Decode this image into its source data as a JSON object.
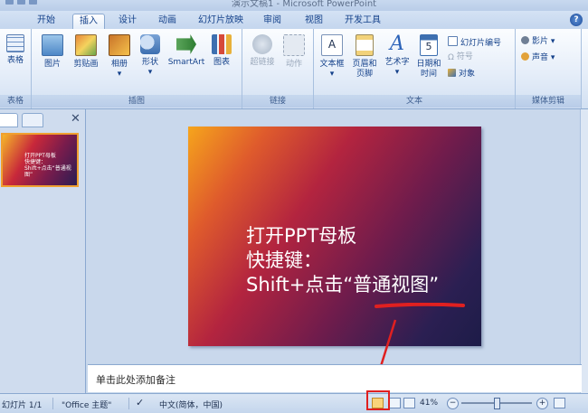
{
  "window": {
    "title": "演示文稿1 - Microsoft PowerPoint"
  },
  "tabs": [
    {
      "label": "开始"
    },
    {
      "label": "插入",
      "active": true
    },
    {
      "label": "设计"
    },
    {
      "label": "动画"
    },
    {
      "label": "幻灯片放映"
    },
    {
      "label": "审阅"
    },
    {
      "label": "视图"
    },
    {
      "label": "开发工具"
    }
  ],
  "ribbon": {
    "groups": {
      "tables": "表格",
      "illustrations": "插图",
      "links": "链接",
      "text": "文本",
      "media": "媒体剪辑"
    },
    "buttons": {
      "table": "表格",
      "picture": "图片",
      "clipart": "剪贴画",
      "album": "相册",
      "shapes": "形状",
      "smartart": "SmartArt",
      "chart": "图表",
      "hyperlink": "超链接",
      "action": "动作",
      "textbox": "文本框",
      "header_footer_1": "页眉和",
      "header_footer_2": "页脚",
      "wordart": "艺术字",
      "datetime_1": "日期和",
      "datetime_2": "时间",
      "slide_number": "幻灯片编号",
      "symbol": "符号",
      "object": "对象",
      "movie": "影片",
      "sound": "声音"
    }
  },
  "slide": {
    "line1": "打开PPT母板",
    "line2": "快捷键：",
    "line3_prefix": "Shift+点击",
    "line3_highlight": "“普通视图”"
  },
  "thumbnail": {
    "line1": "打开PPT母板",
    "line2": "快捷键：",
    "line3": "Shift+点击“普通视图”"
  },
  "notes": {
    "placeholder": "单击此处添加备注"
  },
  "status": {
    "slide_index": "幻灯片 1/1",
    "theme": "\"Office 主题\"",
    "language": "中文(简体，中国)",
    "zoom": "41%"
  },
  "colors": {
    "annotation": "#e02020",
    "ribbon_text": "#15428b"
  }
}
